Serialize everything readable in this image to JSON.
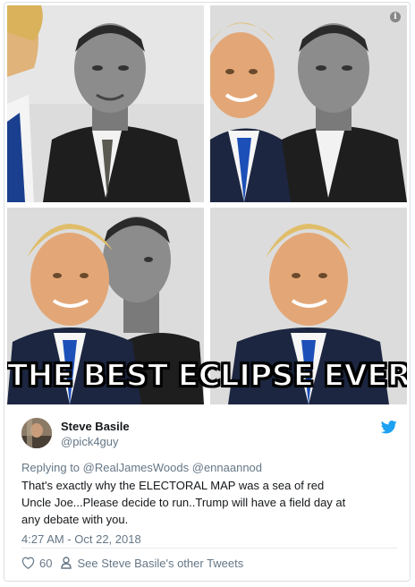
{
  "meme": {
    "caption": "THE BEST ECLIPSE EVER!",
    "panels": [
      {
        "name": "meme-panel-1"
      },
      {
        "name": "meme-panel-2"
      },
      {
        "name": "meme-panel-3"
      },
      {
        "name": "meme-panel-4"
      }
    ],
    "info_icon": "i"
  },
  "tweet": {
    "author_name": "Steve Basile",
    "author_handle": "@pick4guy",
    "reply_prefix": "Replying to",
    "reply_to": [
      "@RealJamesWoods",
      "@ennaannod"
    ],
    "text_lines": [
      "That's exactly why the ELECTORAL  MAP was a sea of red",
      "Uncle Joe...Please decide to run..Trump will have a field day at",
      "any debate with you."
    ],
    "timestamp": "4:27 AM - Oct 22, 2018",
    "like_count": "60",
    "other_tweets_link": "See Steve Basile's other Tweets"
  },
  "icons": {
    "bird": "twitter-bird-icon",
    "heart": "heart-icon",
    "person": "person-icon",
    "info": "info-icon"
  },
  "colors": {
    "twitter_blue": "#1da1f2",
    "text": "#14171a",
    "secondary": "#657786",
    "border": "#dadfe3"
  }
}
